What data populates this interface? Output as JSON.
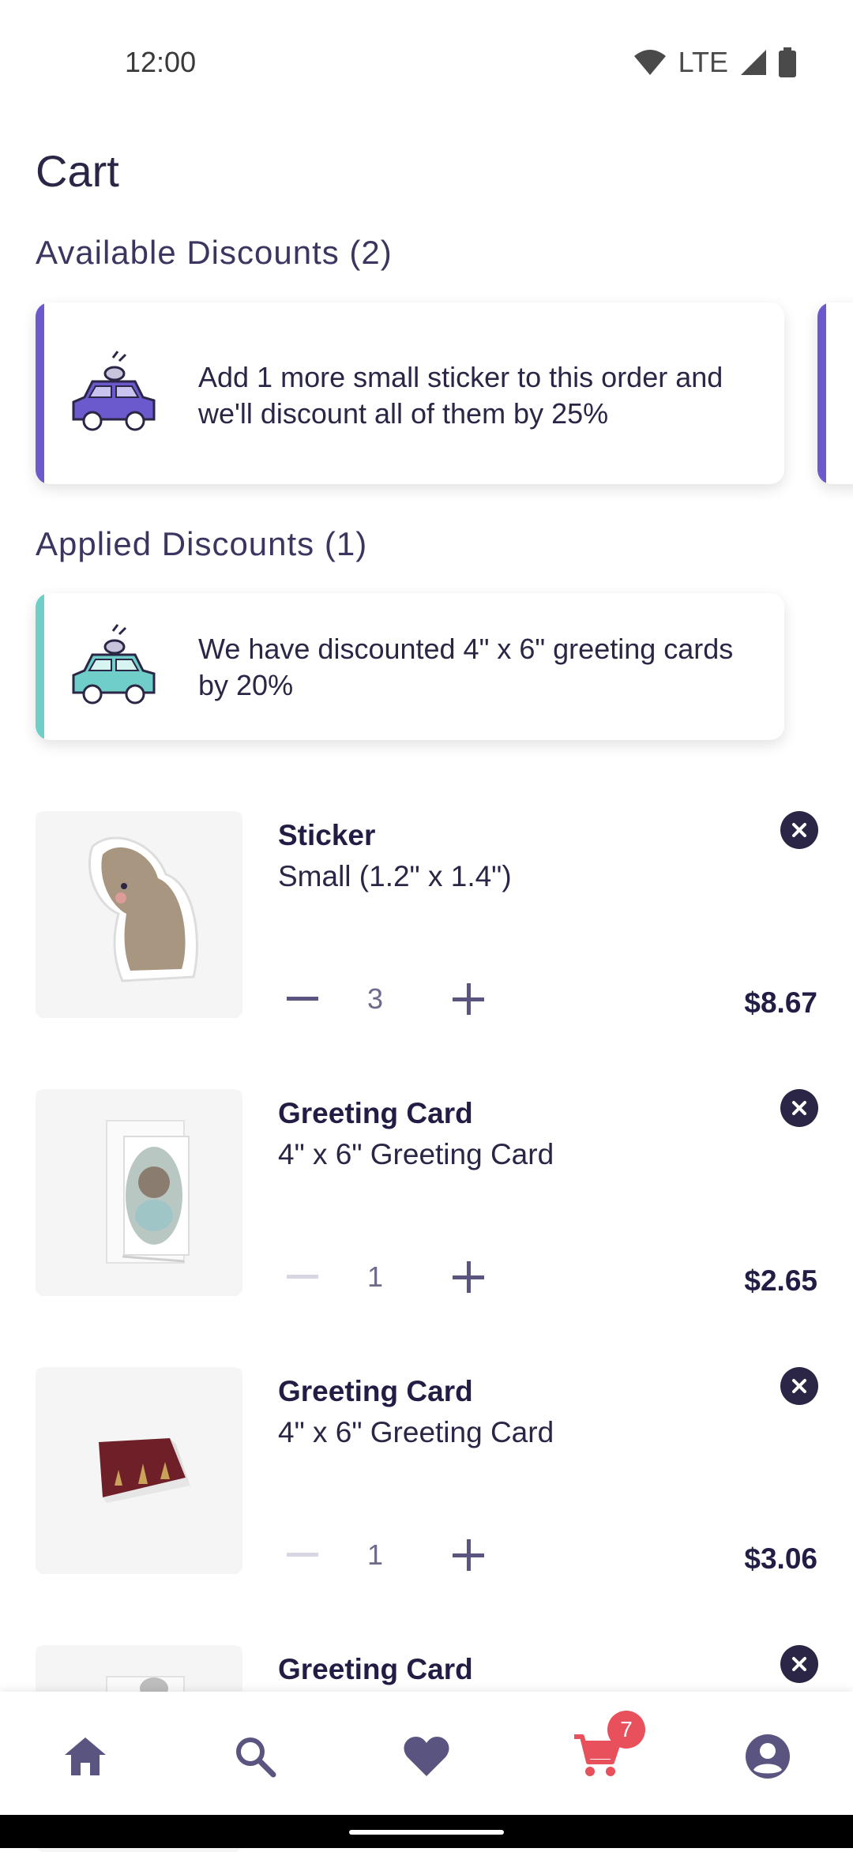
{
  "status_bar": {
    "time": "12:00",
    "network": "LTE"
  },
  "page": {
    "title": "Cart"
  },
  "available_discounts": {
    "heading": "Available Discounts (2)",
    "cards": [
      {
        "text": "Add 1 more small sticker to this order and we'll discount all of them by 25%",
        "accent": "#6a5acd",
        "icon": "car-icon"
      }
    ]
  },
  "applied_discounts": {
    "heading": "Applied Discounts (1)",
    "cards": [
      {
        "text": "We have discounted 4\" x 6\" greeting cards by 20%",
        "accent": "#6fcfc8",
        "icon": "car-icon"
      }
    ]
  },
  "cart_items": [
    {
      "name": "Sticker",
      "variant": "Small (1.2\" x 1.4\")",
      "quantity": "3",
      "price": "$8.67",
      "thumb": "elephant-sticker"
    },
    {
      "name": "Greeting Card",
      "variant": "4\" x 6\" Greeting Card",
      "quantity": "1",
      "price": "$2.65",
      "thumb": "bear-card"
    },
    {
      "name": "Greeting Card",
      "variant": "4\" x 6\" Greeting Card",
      "quantity": "1",
      "price": "$3.06",
      "thumb": "red-card"
    },
    {
      "name": "Greeting Card",
      "variant": "",
      "quantity": "",
      "price": "",
      "thumb": "card"
    }
  ],
  "bottom_nav": {
    "items": [
      "home-icon",
      "search-icon",
      "heart-icon",
      "cart-icon",
      "account-icon"
    ],
    "cart_badge": "7",
    "active_color": "#e8505b",
    "inactive_color": "#5a5480"
  }
}
